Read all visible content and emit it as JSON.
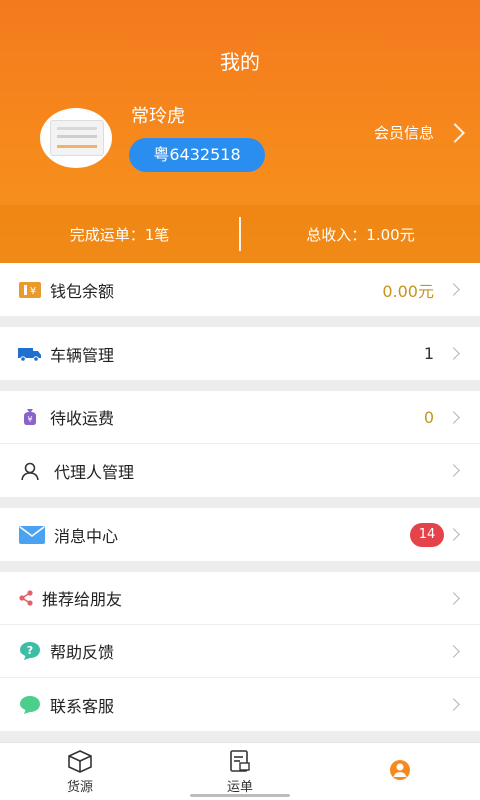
{
  "header": {
    "title": "我的",
    "username": "常玲虎",
    "plate": "粤6432518",
    "member_label": "会员信息"
  },
  "stats": {
    "completed": "完成运单：1笔",
    "income": "总收入：1.00元"
  },
  "menu": {
    "wallet": {
      "label": "钱包余额",
      "value": "0.00元",
      "icon": "wallet-icon"
    },
    "vehicle": {
      "label": "车辆管理",
      "value": "1",
      "icon": "truck-icon"
    },
    "freight": {
      "label": "待收运费",
      "value": "0",
      "icon": "money-bag-icon"
    },
    "agent": {
      "label": "代理人管理",
      "icon": "person-icon"
    },
    "message": {
      "label": "消息中心",
      "badge": "14",
      "icon": "mail-icon"
    },
    "share": {
      "label": "推荐给朋友",
      "icon": "share-icon"
    },
    "help": {
      "label": "帮助反馈",
      "icon": "help-icon"
    },
    "service": {
      "label": "联系客服",
      "icon": "chat-icon"
    }
  },
  "tabbar": {
    "tabs": [
      {
        "label": "货源",
        "icon": "box-icon"
      },
      {
        "label": "运单",
        "icon": "waybill-icon"
      },
      {
        "label": "",
        "icon": "profile-icon"
      }
    ]
  },
  "colors": {
    "brand_orange": "#f6891c",
    "plate_blue": "#2a8ef0",
    "value_gold": "#c8941c",
    "badge_red": "#e5434a"
  }
}
